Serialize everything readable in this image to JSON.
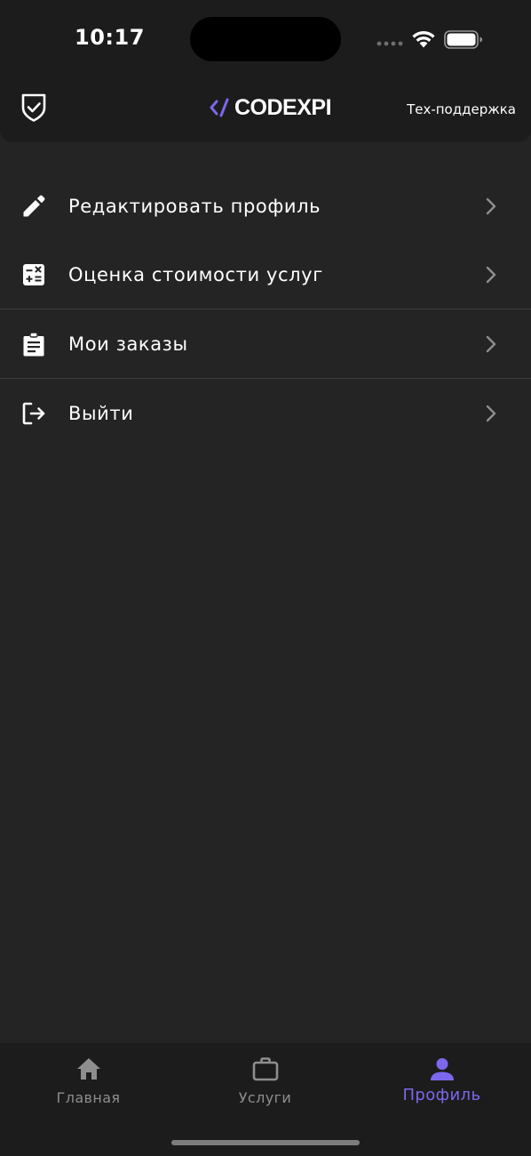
{
  "status_bar": {
    "time": "10:17"
  },
  "header": {
    "logo_text": "CODEXPI",
    "support_label": "Тех-поддержка",
    "accent_color": "#7b68ee"
  },
  "menu": {
    "items": [
      {
        "label": "Редактировать профиль",
        "icon": "pencil-icon"
      },
      {
        "label": "Оценка стоимости услуг",
        "icon": "calculator-icon"
      },
      {
        "label": "Мои заказы",
        "icon": "clipboard-icon"
      },
      {
        "label": "Выйти",
        "icon": "logout-icon"
      }
    ]
  },
  "tab_bar": {
    "tabs": [
      {
        "label": "Главная",
        "icon": "home-icon",
        "active": false
      },
      {
        "label": "Услуги",
        "icon": "briefcase-icon",
        "active": false
      },
      {
        "label": "Профиль",
        "icon": "person-icon",
        "active": true
      }
    ]
  },
  "colors": {
    "background": "#242424",
    "bars": "#1c1c1c",
    "active_tab": "#7b68ee",
    "inactive_tab": "#8e8e8e"
  }
}
